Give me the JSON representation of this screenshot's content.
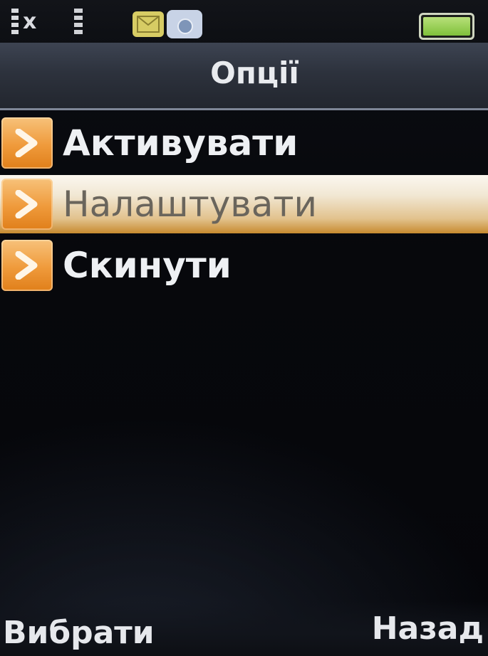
{
  "status_bar": {
    "icons": [
      "signal-no-service-icon",
      "data-icon",
      "message-icon",
      "settings-icon",
      "battery-icon"
    ],
    "battery_level": 1.0,
    "message_icon_color": "#d7cc64",
    "battery_color": "#8ccc44"
  },
  "header": {
    "title": "Опції"
  },
  "menu": {
    "items": [
      {
        "label": "Активувати",
        "selected": false
      },
      {
        "label": "Налаштувати",
        "selected": true
      },
      {
        "label": "Скинути",
        "selected": false
      }
    ],
    "accent_color": "#ef9a3b",
    "highlight_color": "#e2c28d"
  },
  "softkeys": {
    "left": "Вибрати",
    "right": "Назад"
  }
}
